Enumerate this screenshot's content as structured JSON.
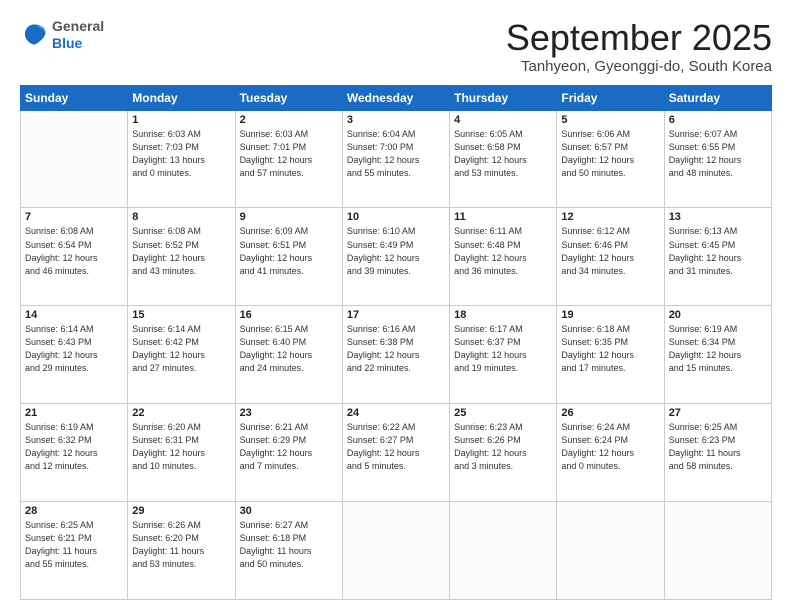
{
  "logo": {
    "general": "General",
    "blue": "Blue"
  },
  "header": {
    "month": "September 2025",
    "location": "Tanhyeon, Gyeonggi-do, South Korea"
  },
  "weekdays": [
    "Sunday",
    "Monday",
    "Tuesday",
    "Wednesday",
    "Thursday",
    "Friday",
    "Saturday"
  ],
  "weeks": [
    [
      {
        "day": "",
        "info": ""
      },
      {
        "day": "1",
        "info": "Sunrise: 6:03 AM\nSunset: 7:03 PM\nDaylight: 13 hours\nand 0 minutes."
      },
      {
        "day": "2",
        "info": "Sunrise: 6:03 AM\nSunset: 7:01 PM\nDaylight: 12 hours\nand 57 minutes."
      },
      {
        "day": "3",
        "info": "Sunrise: 6:04 AM\nSunset: 7:00 PM\nDaylight: 12 hours\nand 55 minutes."
      },
      {
        "day": "4",
        "info": "Sunrise: 6:05 AM\nSunset: 6:58 PM\nDaylight: 12 hours\nand 53 minutes."
      },
      {
        "day": "5",
        "info": "Sunrise: 6:06 AM\nSunset: 6:57 PM\nDaylight: 12 hours\nand 50 minutes."
      },
      {
        "day": "6",
        "info": "Sunrise: 6:07 AM\nSunset: 6:55 PM\nDaylight: 12 hours\nand 48 minutes."
      }
    ],
    [
      {
        "day": "7",
        "info": "Sunrise: 6:08 AM\nSunset: 6:54 PM\nDaylight: 12 hours\nand 46 minutes."
      },
      {
        "day": "8",
        "info": "Sunrise: 6:08 AM\nSunset: 6:52 PM\nDaylight: 12 hours\nand 43 minutes."
      },
      {
        "day": "9",
        "info": "Sunrise: 6:09 AM\nSunset: 6:51 PM\nDaylight: 12 hours\nand 41 minutes."
      },
      {
        "day": "10",
        "info": "Sunrise: 6:10 AM\nSunset: 6:49 PM\nDaylight: 12 hours\nand 39 minutes."
      },
      {
        "day": "11",
        "info": "Sunrise: 6:11 AM\nSunset: 6:48 PM\nDaylight: 12 hours\nand 36 minutes."
      },
      {
        "day": "12",
        "info": "Sunrise: 6:12 AM\nSunset: 6:46 PM\nDaylight: 12 hours\nand 34 minutes."
      },
      {
        "day": "13",
        "info": "Sunrise: 6:13 AM\nSunset: 6:45 PM\nDaylight: 12 hours\nand 31 minutes."
      }
    ],
    [
      {
        "day": "14",
        "info": "Sunrise: 6:14 AM\nSunset: 6:43 PM\nDaylight: 12 hours\nand 29 minutes."
      },
      {
        "day": "15",
        "info": "Sunrise: 6:14 AM\nSunset: 6:42 PM\nDaylight: 12 hours\nand 27 minutes."
      },
      {
        "day": "16",
        "info": "Sunrise: 6:15 AM\nSunset: 6:40 PM\nDaylight: 12 hours\nand 24 minutes."
      },
      {
        "day": "17",
        "info": "Sunrise: 6:16 AM\nSunset: 6:38 PM\nDaylight: 12 hours\nand 22 minutes."
      },
      {
        "day": "18",
        "info": "Sunrise: 6:17 AM\nSunset: 6:37 PM\nDaylight: 12 hours\nand 19 minutes."
      },
      {
        "day": "19",
        "info": "Sunrise: 6:18 AM\nSunset: 6:35 PM\nDaylight: 12 hours\nand 17 minutes."
      },
      {
        "day": "20",
        "info": "Sunrise: 6:19 AM\nSunset: 6:34 PM\nDaylight: 12 hours\nand 15 minutes."
      }
    ],
    [
      {
        "day": "21",
        "info": "Sunrise: 6:19 AM\nSunset: 6:32 PM\nDaylight: 12 hours\nand 12 minutes."
      },
      {
        "day": "22",
        "info": "Sunrise: 6:20 AM\nSunset: 6:31 PM\nDaylight: 12 hours\nand 10 minutes."
      },
      {
        "day": "23",
        "info": "Sunrise: 6:21 AM\nSunset: 6:29 PM\nDaylight: 12 hours\nand 7 minutes."
      },
      {
        "day": "24",
        "info": "Sunrise: 6:22 AM\nSunset: 6:27 PM\nDaylight: 12 hours\nand 5 minutes."
      },
      {
        "day": "25",
        "info": "Sunrise: 6:23 AM\nSunset: 6:26 PM\nDaylight: 12 hours\nand 3 minutes."
      },
      {
        "day": "26",
        "info": "Sunrise: 6:24 AM\nSunset: 6:24 PM\nDaylight: 12 hours\nand 0 minutes."
      },
      {
        "day": "27",
        "info": "Sunrise: 6:25 AM\nSunset: 6:23 PM\nDaylight: 11 hours\nand 58 minutes."
      }
    ],
    [
      {
        "day": "28",
        "info": "Sunrise: 6:25 AM\nSunset: 6:21 PM\nDaylight: 11 hours\nand 55 minutes."
      },
      {
        "day": "29",
        "info": "Sunrise: 6:26 AM\nSunset: 6:20 PM\nDaylight: 11 hours\nand 53 minutes."
      },
      {
        "day": "30",
        "info": "Sunrise: 6:27 AM\nSunset: 6:18 PM\nDaylight: 11 hours\nand 50 minutes."
      },
      {
        "day": "",
        "info": ""
      },
      {
        "day": "",
        "info": ""
      },
      {
        "day": "",
        "info": ""
      },
      {
        "day": "",
        "info": ""
      }
    ]
  ]
}
